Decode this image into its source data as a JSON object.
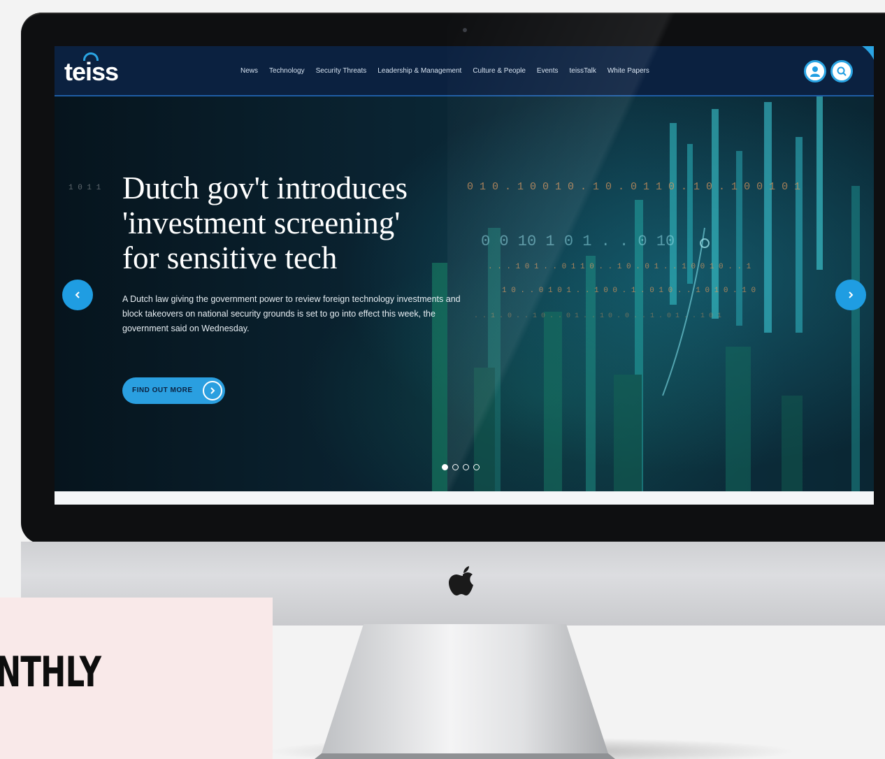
{
  "nav": {
    "logo": "teiss",
    "links": [
      "News",
      "Technology",
      "Security Threats",
      "Leadership & Management",
      "Culture & People",
      "Events",
      "teissTalk",
      "White Papers"
    ]
  },
  "hero": {
    "headline_lines": [
      "Dutch gov't introduces",
      "'investment screening'",
      "for sensitive tech"
    ],
    "summary": "A Dutch law giving the government power to review foreign technology investments and block takeovers on national security grounds is set to go into effect this week, the government said on Wednesday.",
    "cta_label": "FIND OUT MORE",
    "slides_total": 4,
    "active_slide": 1
  },
  "overlay": {
    "text": "NTHLY"
  },
  "icons": [
    "user-icon",
    "search-icon",
    "chevron-left-icon",
    "chevron-right-icon",
    "arrow-right-icon",
    "apple-logo-icon"
  ],
  "colors": {
    "nav_bg": "#0b2140",
    "accent": "#2aa4e3",
    "overlay_bg": "#f9e9e9"
  }
}
